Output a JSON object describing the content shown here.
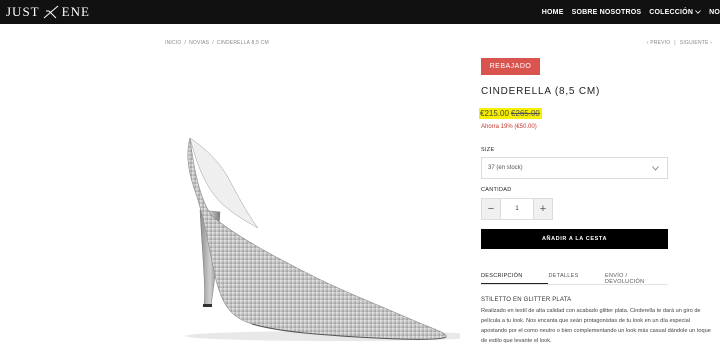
{
  "header": {
    "logo_left": "JUST",
    "logo_right": "ENE",
    "nav": [
      {
        "label": "HOME",
        "icon": null
      },
      {
        "label": "SOBRE NOSOTROS",
        "icon": null
      },
      {
        "label": "COLECCIÓN",
        "icon": "chevron-down-icon"
      },
      {
        "label": "NO",
        "icon": null
      }
    ]
  },
  "breadcrumb": [
    "INICIO",
    "/",
    "NOVIAS",
    "/",
    "CINDERELLA 8,5 CM"
  ],
  "pager": {
    "prev": "‹ PREVIO",
    "separator": "|",
    "next": "SIGUIENTE ›"
  },
  "product": {
    "badge": "REBAJADO",
    "title": "CINDERELLA (8,5 CM)",
    "price_sale": "€215.00",
    "price_old": "€265.00",
    "saving": "Ahorra 19% (€50.00)",
    "size_label": "SIZE",
    "size_value": "37 (en stock)",
    "quantity_label": "CANTIDAD",
    "quantity_value": "1",
    "minus": "−",
    "plus": "+",
    "add_to_cart": "AÑADIR A LA CESTA",
    "tabs": [
      {
        "label": "DESCRIPCIÓN",
        "active": true
      },
      {
        "label": "DETALLES",
        "active": false
      },
      {
        "label": "ENVÍO / DEVOLUCIÓN",
        "active": false
      }
    ],
    "description_title": "STILETTO EN GLITTER PLATA",
    "description_text": "Realizado en textil de alta calidad con acabado glitter plata. Cinderella te dará un giro de película a tu look. Nos encanta que seán protagonistas de tu look en un día especial apostando por el como neutro o bien complementando un look más casual dándole un toque de estilo que levante el look."
  },
  "colors": {
    "topbar": "#111111",
    "badge": "#d9534f",
    "highlight": "#f6f000",
    "saving": "#c0392b",
    "button": "#000000"
  }
}
